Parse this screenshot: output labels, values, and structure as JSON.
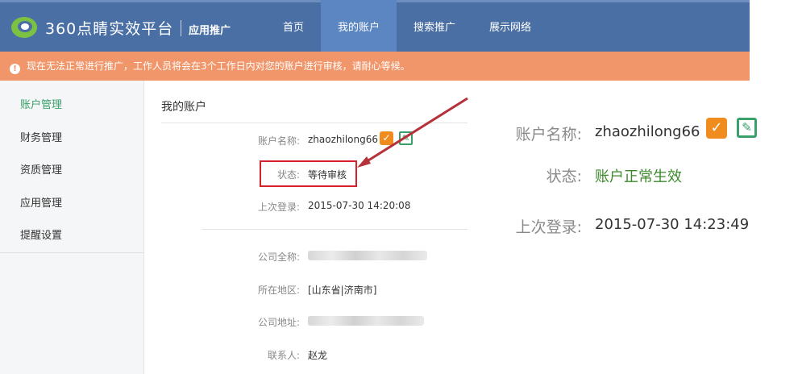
{
  "header": {
    "brand": "360点睛实效平台",
    "sub_title": "应用推广",
    "nav": [
      "首页",
      "我的账户",
      "搜索推广",
      "展示网络"
    ],
    "active_nav": "我的账户"
  },
  "notice": {
    "icon": "warning-icon",
    "text": "现在无法正常进行推广，工作人员将会在3个工作日内对您的账户进行审核，请耐心等候。"
  },
  "sidebar": {
    "items": [
      {
        "label": "账户管理",
        "active": true
      },
      {
        "label": "财务管理"
      },
      {
        "label": "资质管理"
      },
      {
        "label": "应用管理"
      },
      {
        "label": "提醒设置"
      }
    ]
  },
  "account": {
    "section_title": "我的账户",
    "fields": [
      {
        "label": "账户名称:",
        "value": "zhaozhilong66"
      },
      {
        "label": "状态:",
        "value": "等待审核"
      },
      {
        "label": "上次登录:",
        "value": "2015-07-30 14:20:08"
      },
      {
        "label": "公司全称:",
        "value": ""
      },
      {
        "label": "所在地区:",
        "value": "[山东省|济南市]"
      },
      {
        "label": "公司地址:",
        "value": ""
      },
      {
        "label": "联系人:",
        "value": "赵龙"
      }
    ]
  },
  "callout": {
    "fields": [
      {
        "label": "账户名称:",
        "value": "zhaozhilong66"
      },
      {
        "label": "状态:",
        "value": "账户正常生效"
      },
      {
        "label": "上次登录:",
        "value": "2015-07-30 14:23:49"
      }
    ]
  },
  "colors": {
    "topbar": "#4a6fa5",
    "nav_active": "#5b86c2",
    "notice": "#f0966a",
    "accent_green": "#3aa06a",
    "check_orange": "#f08c1e",
    "highlight_red": "#d6202a"
  }
}
